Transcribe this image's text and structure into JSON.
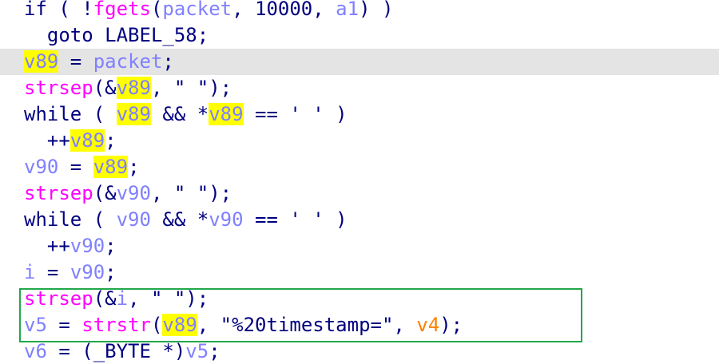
{
  "editor": {
    "lines": [
      {
        "tokens": [
          {
            "t": "if ( ",
            "c": "kw"
          },
          {
            "t": "!",
            "c": "op"
          },
          {
            "t": "fgets",
            "c": "fn"
          },
          {
            "t": "(",
            "c": "op"
          },
          {
            "t": "packet",
            "c": "lv"
          },
          {
            "t": ", 10000, ",
            "c": "num"
          },
          {
            "t": "a1",
            "c": "a1"
          },
          {
            "t": ") )",
            "c": "op"
          }
        ]
      },
      {
        "tokens": [
          {
            "t": "  goto ",
            "c": "kw"
          },
          {
            "t": "LABEL_58",
            "c": "lbl"
          },
          {
            "t": ";",
            "c": "op"
          }
        ]
      },
      {
        "current": true,
        "tokens": [
          {
            "t": "v89",
            "c": "lv",
            "hl": true
          },
          {
            "t": " = ",
            "c": "op"
          },
          {
            "t": "packet",
            "c": "lv"
          },
          {
            "t": ";",
            "c": "op"
          }
        ]
      },
      {
        "tokens": [
          {
            "t": "strsep",
            "c": "fn"
          },
          {
            "t": "(&",
            "c": "op"
          },
          {
            "t": "v89",
            "c": "lv",
            "hl": true
          },
          {
            "t": ", \" \");",
            "c": "str"
          }
        ]
      },
      {
        "tokens": [
          {
            "t": "while",
            "c": "kw"
          },
          {
            "t": " ( ",
            "c": "op"
          },
          {
            "t": "v89",
            "c": "lv",
            "hl": true
          },
          {
            "t": " && *",
            "c": "op"
          },
          {
            "t": "v89",
            "c": "lv",
            "hl": true
          },
          {
            "t": " == ' ' )",
            "c": "op"
          }
        ]
      },
      {
        "tokens": [
          {
            "t": "  ++",
            "c": "op"
          },
          {
            "t": "v89",
            "c": "lv",
            "hl": true
          },
          {
            "t": ";",
            "c": "op"
          }
        ]
      },
      {
        "tokens": [
          {
            "t": "v90",
            "c": "lv"
          },
          {
            "t": " = ",
            "c": "op"
          },
          {
            "t": "v89",
            "c": "lv",
            "hl": true
          },
          {
            "t": ";",
            "c": "op"
          }
        ]
      },
      {
        "tokens": [
          {
            "t": "strsep",
            "c": "fn"
          },
          {
            "t": "(&",
            "c": "op"
          },
          {
            "t": "v90",
            "c": "lv"
          },
          {
            "t": ", \" \");",
            "c": "str"
          }
        ]
      },
      {
        "tokens": [
          {
            "t": "while",
            "c": "kw"
          },
          {
            "t": " ( ",
            "c": "op"
          },
          {
            "t": "v90",
            "c": "lv"
          },
          {
            "t": " && *",
            "c": "op"
          },
          {
            "t": "v90",
            "c": "lv"
          },
          {
            "t": " == ' ' )",
            "c": "op"
          }
        ]
      },
      {
        "tokens": [
          {
            "t": "  ++",
            "c": "op"
          },
          {
            "t": "v90",
            "c": "lv"
          },
          {
            "t": ";",
            "c": "op"
          }
        ]
      },
      {
        "tokens": [
          {
            "t": "i",
            "c": "lv"
          },
          {
            "t": " = ",
            "c": "op"
          },
          {
            "t": "v90",
            "c": "lv"
          },
          {
            "t": ";",
            "c": "op"
          }
        ]
      },
      {
        "tokens": [
          {
            "t": "strsep",
            "c": "fn"
          },
          {
            "t": "(&",
            "c": "op"
          },
          {
            "t": "i",
            "c": "lv"
          },
          {
            "t": ", \" \");",
            "c": "str"
          }
        ]
      },
      {
        "tokens": [
          {
            "t": "v5",
            "c": "lv"
          },
          {
            "t": " = ",
            "c": "op"
          },
          {
            "t": "strstr",
            "c": "fn"
          },
          {
            "t": "(",
            "c": "op"
          },
          {
            "t": "v89",
            "c": "lv",
            "hl": true
          },
          {
            "t": ", \"%20timestamp=\", ",
            "c": "str"
          },
          {
            "t": "v4",
            "c": "arg"
          },
          {
            "t": ");",
            "c": "op"
          }
        ]
      },
      {
        "tokens": [
          {
            "t": "v6",
            "c": "lv"
          },
          {
            "t": " = (_BYTE *)",
            "c": "op"
          },
          {
            "t": "v5",
            "c": "lv"
          },
          {
            "t": ";",
            "c": "op"
          }
        ]
      }
    ]
  },
  "colors": {
    "background": "#ffffff",
    "current_line": "#e4e4e4",
    "keyword": "#000080",
    "function": "#ff00ff",
    "variable": "#8080ff",
    "argument": "#ff8000",
    "highlight": "#ffff00",
    "selection_box": "#22a84a"
  }
}
